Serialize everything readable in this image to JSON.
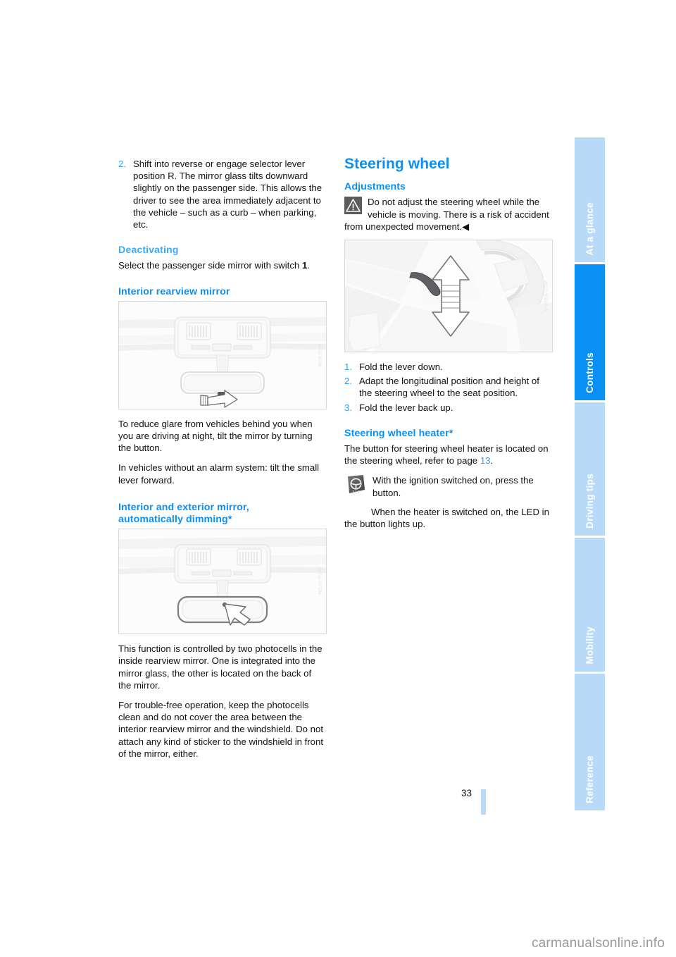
{
  "document": {
    "page_number": "33",
    "watermark": "carmanualsonline.info"
  },
  "sidebar": {
    "tabs": [
      {
        "label": "At a glance",
        "active": false
      },
      {
        "label": "Controls",
        "active": true
      },
      {
        "label": "Driving tips",
        "active": false
      },
      {
        "label": "Mobility",
        "active": false
      },
      {
        "label": "Reference",
        "active": false
      }
    ]
  },
  "colors": {
    "heading_blue": "#0a8ff5",
    "subheading_blue": "#3fa9f5",
    "tab_inactive": "#b8daf8",
    "tab_active": "#0a8ff5",
    "warning_icon_bg": "#5c5c5c"
  },
  "left_column": {
    "step2": {
      "number": "2.",
      "text": "Shift into reverse or engage selector lever position R. The mirror glass tilts downward slightly on the passenger side. This allows the driver to see the area immediately adjacent to the vehicle – such as a curb – when parking, etc."
    },
    "deactivating": {
      "heading": "Deactivating",
      "body_start": "Select the passenger side mirror with switch ",
      "body_bold": "1",
      "body_end": "."
    },
    "interior_rearview_mirror": {
      "heading": "Interior rearview mirror",
      "figure_code": "WCD-BDM",
      "para1": "To reduce glare from vehicles behind you when you are driving at night, tilt the mirror by turning the button.",
      "para2": "In vehicles without an alarm system: tilt the small lever forward."
    },
    "auto_dimming": {
      "heading_line1": "Interior and exterior mirror,",
      "heading_line2": "automatically dimming*",
      "figure_code": "WCD-HFDM",
      "para1": "This function is controlled by two photocells in the inside rearview mirror. One is integrated into the mirror glass, the other is located on the back of the mirror.",
      "para2": "For trouble-free operation, keep the photocells clean and do not cover the area between the interior rearview mirror and the windshield. Do not attach any kind of sticker to the windshield in front of the mirror, either."
    }
  },
  "right_column": {
    "title": "Steering wheel",
    "adjustments": {
      "heading": "Adjustments",
      "warning_text": "Do not adjust the steering wheel while the vehicle is moving. There is a risk of accident from unexpected movement.",
      "warning_end_marker": "◀",
      "figure_code": "WCD-RSSA-A",
      "steps": [
        {
          "number": "1.",
          "text": "Fold the lever down."
        },
        {
          "number": "2.",
          "text": "Adapt the longitudinal position and height of the steering wheel to the seat position."
        },
        {
          "number": "3.",
          "text": "Fold the lever back up."
        }
      ]
    },
    "heater": {
      "heading": "Steering wheel heater*",
      "para_start": "The button for steering wheel heater is located on the steering wheel, refer to page ",
      "page_ref": "13",
      "para_end": ".",
      "button_text": "With the ignition switched on, press the button.",
      "led_text": "When the heater is switched on, the LED in the button lights up."
    }
  }
}
